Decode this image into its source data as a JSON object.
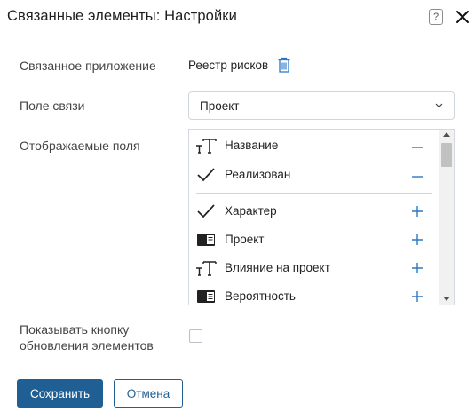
{
  "dialog": {
    "title": "Связанные элементы: Настройки",
    "help_label": "?"
  },
  "form": {
    "app_label": "Связанное приложение",
    "app_value": "Реестр рисков",
    "field_label": "Поле связи",
    "field_value": "Проект",
    "display_label": "Отображаемые поля",
    "refresh_label": "Показывать кнопку обновления элементов",
    "refresh_checked": false
  },
  "fields": {
    "selected": [
      {
        "icon": "text-type-icon",
        "label": "Название",
        "action": "remove"
      },
      {
        "icon": "checkmark-icon",
        "label": "Реализован",
        "action": "remove"
      }
    ],
    "available": [
      {
        "icon": "checkmark-icon",
        "label": "Характер",
        "action": "add"
      },
      {
        "icon": "card-type-icon",
        "label": "Проект",
        "action": "add"
      },
      {
        "icon": "text-type-icon",
        "label": "Влияние на проект",
        "action": "add"
      },
      {
        "icon": "card-type-icon",
        "label": "Вероятность",
        "action": "add"
      }
    ]
  },
  "buttons": {
    "save": "Сохранить",
    "cancel": "Отмена"
  },
  "colors": {
    "primary": "#1f5f94",
    "action_icon": "#2b78c2"
  }
}
